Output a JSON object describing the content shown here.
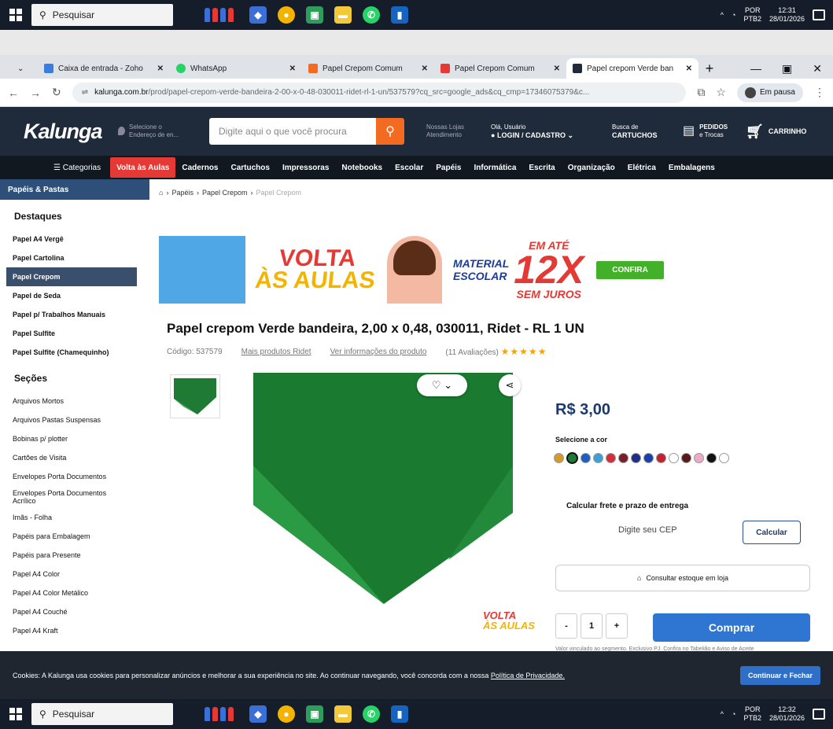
{
  "taskbar_top": {
    "search_label": "Pesquisar",
    "lang": "POR",
    "kbd": "PTB2",
    "time": "12:31",
    "date": "28/01/2026"
  },
  "taskbar_bottom": {
    "search_label": "Pesquisar",
    "lang": "POR",
    "kbd": "PTB2",
    "time": "12:32",
    "date": "28/01/2026"
  },
  "browser": {
    "tabs": [
      {
        "label": "Caixa de entrada - Zoho",
        "fav": "#3b7ddd"
      },
      {
        "label": "WhatsApp",
        "fav": "#25d366"
      },
      {
        "label": "Papel Crepom Comum",
        "fav": "#f26b21"
      },
      {
        "label": "Papel Crepom Comum",
        "fav": "#e53935"
      },
      {
        "label": "Papel crepom Verde ban",
        "fav": "#1f2a3a"
      }
    ],
    "url_domain": "kalunga.com.br",
    "url_path": "/prod/papel-crepom-verde-bandeira-2-00-x-0-48-030011-ridet-rl-1-un/537579?cq_src=google_ads&cq_cmp=17346075379&c...",
    "paused_label": "Em pausa"
  },
  "site": {
    "logo": "Kalunga",
    "location_line1": "Selecione o",
    "location_line2": "Endereço de en...",
    "search_placeholder": "Digite aqui o que você procura",
    "stores_line1": "Nossas Lojas",
    "stores_line2": "Atendimento",
    "user_greeting": "Olá, Usuário",
    "user_login": "LOGIN / CADASTRO",
    "cart_line1": "Busca de",
    "cart_line2": "CARTUCHOS",
    "orders_line1": "PEDIDOS",
    "orders_line2": "e Trocas",
    "cart_label": "CARRINHO"
  },
  "menu": {
    "categories": "Categorias",
    "items": [
      "Volta às Aulas",
      "Cadernos",
      "Cartuchos",
      "Impressoras",
      "Notebooks",
      "Escolar",
      "Papéis",
      "Informática",
      "Escrita",
      "Organização",
      "Elétrica",
      "Embalagens"
    ]
  },
  "sidebar": {
    "header": "Papéis & Pastas",
    "destaques_title": "Destaques",
    "destaques": [
      "Papel A4 Vergê",
      "Papel Cartolina",
      "Papel Crepom",
      "Papel de Seda",
      "Papel p/ Trabalhos Manuais",
      "Papel Sulfite",
      "Papel Sulfite (Chamequinho)"
    ],
    "secoes_title": "Seções",
    "secoes": [
      "Arquivos Mortos",
      "Arquivos Pastas Suspensas",
      "Bobinas p/ plotter",
      "Cartões de Visita",
      "Envelopes Porta Documentos",
      "Envelopes Porta Documentos Acrílico",
      "Imãs - Folha",
      "Papéis para Embalagem",
      "Papéis para Presente",
      "Papel A4 Color",
      "Papel A4 Color Metálico",
      "Papel A4 Couché",
      "Papel A4 Kraft"
    ]
  },
  "breadcrumb": {
    "items": [
      "Papéis",
      "Papel Crepom",
      "Papel Crepom"
    ]
  },
  "banner": {
    "volta1": "VOLTA",
    "volta2": "ÀS AULAS",
    "material": "MATERIAL",
    "escolar": "ESCOLAR",
    "twelve": "12X",
    "ate": "EM ATÉ",
    "sem_juros": "SEM JUROS",
    "confira": "CONFIRA"
  },
  "product": {
    "title": "Papel crepom Verde bandeira, 2,00 x 0,48, 030011, Ridet - RL 1 UN",
    "code": "Código: 537579",
    "more": "Mais produtos Ridet",
    "info_link": "Ver informações do produto",
    "reviews": "(11 Avaliações)",
    "stars": "★★★★★",
    "price": "R$ 3,00",
    "select_color": "Selecione a cor",
    "colors": [
      "#d49a2a",
      "#1f7a33",
      "#1e5fc4",
      "#3aa0d8",
      "#d32f3a",
      "#7a1e2e",
      "#1c2f8a",
      "#1c3fae",
      "#c4232e",
      "#ffffff",
      "#5a1a1a",
      "#f0a8c8",
      "#111111",
      "#ffffff"
    ],
    "frete_title": "Calcular frete e prazo de entrega",
    "cep_placeholder": "Digite seu CEP",
    "calc_label": "Calcular",
    "stock_label": "Consultar estoque em loja",
    "qty_minus": "-",
    "qty_value": "1",
    "qty_plus": "+",
    "buy_label": "Comprar",
    "note": "Valor vinculado ao segmento. Exclusivo PJ. Confira no Tabelião e Aviso de Aceite"
  },
  "cookie": {
    "text": "Cookies: A Kalunga usa cookies para personalizar anúncios e melhorar a sua experiência no site. Ao continuar navegando, você concorda com a nossa",
    "link": "Política de Privacidade.",
    "button": "Continuar e Fechar"
  }
}
